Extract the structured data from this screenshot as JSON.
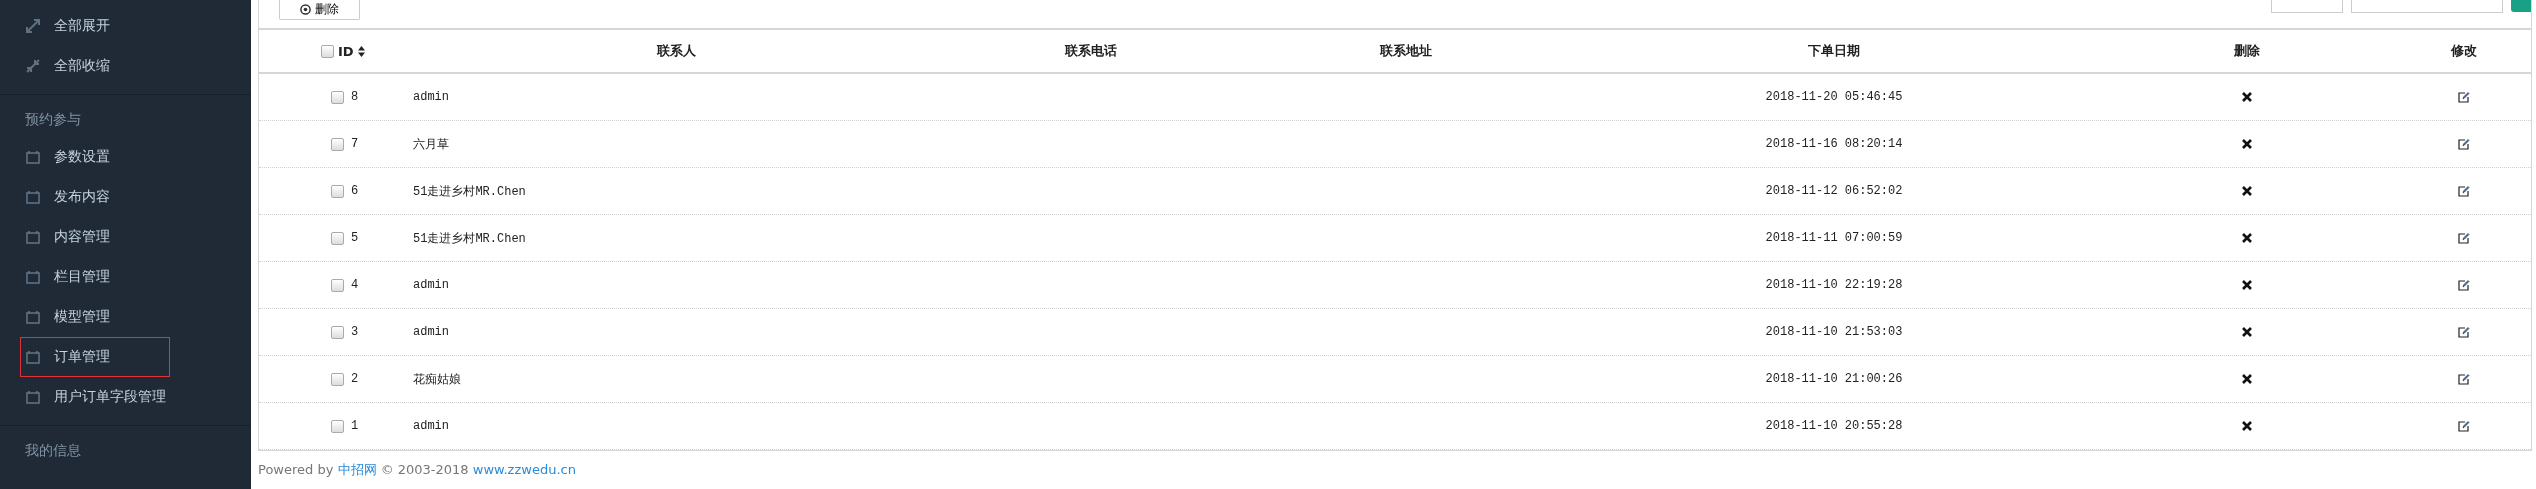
{
  "sidebar": {
    "groups": [
      {
        "items": [
          {
            "label": "全部展开",
            "kind": "expand",
            "outlined": false
          },
          {
            "label": "全部收缩",
            "kind": "compress",
            "outlined": false
          }
        ]
      },
      {
        "heading": "预约参与",
        "items": [
          {
            "label": "参数设置",
            "kind": "calendar",
            "outlined": false
          },
          {
            "label": "发布内容",
            "kind": "calendar",
            "outlined": false
          },
          {
            "label": "内容管理",
            "kind": "calendar",
            "outlined": false
          },
          {
            "label": "栏目管理",
            "kind": "calendar",
            "outlined": false
          },
          {
            "label": "模型管理",
            "kind": "calendar",
            "outlined": false
          },
          {
            "label": "订单管理",
            "kind": "calendar",
            "outlined": true
          },
          {
            "label": "用户订单字段管理",
            "kind": "calendar",
            "outlined": false
          }
        ]
      },
      {
        "heading": "我的信息"
      }
    ]
  },
  "toolbar": {
    "delete_button": "删除"
  },
  "table": {
    "select_all": {
      "checked": false
    },
    "columns": [
      {
        "label": "ID",
        "sortable": true
      },
      {
        "label": "联系人",
        "sortable": false
      },
      {
        "label": "联系电话",
        "sortable": false
      },
      {
        "label": "联系地址",
        "sortable": false
      },
      {
        "label": "下单日期",
        "sortable": false
      },
      {
        "label": "删除",
        "sortable": false
      },
      {
        "label": "修改",
        "sortable": false
      }
    ],
    "rows": [
      {
        "id": "8",
        "contact": "admin",
        "date": "2018-11-20 05:46:45",
        "checked": false
      },
      {
        "id": "7",
        "contact": "六月草",
        "date": "2018-11-16 08:20:14",
        "checked": false
      },
      {
        "id": "6",
        "contact": "51走进乡村MR.Chen",
        "date": "2018-11-12 06:52:02",
        "checked": false
      },
      {
        "id": "5",
        "contact": "51走进乡村MR.Chen",
        "date": "2018-11-11 07:00:59",
        "checked": false
      },
      {
        "id": "4",
        "contact": "admin",
        "date": "2018-11-10 22:19:28",
        "checked": false
      },
      {
        "id": "3",
        "contact": "admin",
        "date": "2018-11-10 21:53:03",
        "checked": false
      },
      {
        "id": "2",
        "contact": "花痴姑娘",
        "date": "2018-11-10 21:00:26",
        "checked": false
      },
      {
        "id": "1",
        "contact": "admin",
        "date": "2018-11-10 20:55:28",
        "checked": false
      }
    ]
  },
  "footer": {
    "prefix": "Powered by",
    "site_link": "中招网",
    "copyright": "© 2003-2018",
    "url_link": "www.zzwedu.cn"
  }
}
